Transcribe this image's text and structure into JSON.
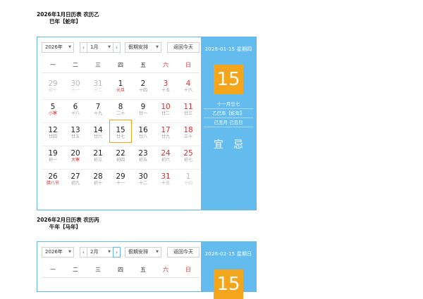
{
  "months": [
    {
      "title_line1": "2026年1月日历表  农历乙",
      "title_line2": "巳年【蛇年】",
      "toolbar": {
        "year": "2026年",
        "prev": "‹",
        "month": "1月",
        "next": "›",
        "holiday": "假期安排",
        "today": "返回今天"
      },
      "weekdays": [
        "一",
        "二",
        "三",
        "四",
        "五",
        "六",
        "日"
      ],
      "weeks": [
        [
          {
            "d": "29",
            "l": "初十",
            "o": true
          },
          {
            "d": "30",
            "l": "十一",
            "o": true
          },
          {
            "d": "31",
            "l": "十二",
            "o": true
          },
          {
            "d": "1",
            "l": "元旦",
            "f": true
          },
          {
            "d": "2",
            "l": "十四"
          },
          {
            "d": "3",
            "l": "十五",
            "w": true
          },
          {
            "d": "4",
            "l": "十六",
            "w": true
          }
        ],
        [
          {
            "d": "5",
            "l": "小寒",
            "f": true
          },
          {
            "d": "6",
            "l": "十八"
          },
          {
            "d": "7",
            "l": "十九"
          },
          {
            "d": "8",
            "l": "二十"
          },
          {
            "d": "9",
            "l": "廿一"
          },
          {
            "d": "10",
            "l": "廿二",
            "w": true
          },
          {
            "d": "11",
            "l": "廿三",
            "w": true
          }
        ],
        [
          {
            "d": "12",
            "l": "廿四"
          },
          {
            "d": "13",
            "l": "廿五"
          },
          {
            "d": "14",
            "l": "廿六"
          },
          {
            "d": "15",
            "l": "廿七",
            "s": true
          },
          {
            "d": "16",
            "l": "廿八"
          },
          {
            "d": "17",
            "l": "廿九",
            "w": true
          },
          {
            "d": "18",
            "l": "三十",
            "w": true
          }
        ],
        [
          {
            "d": "19",
            "l": "初一"
          },
          {
            "d": "20",
            "l": "大寒",
            "f": true
          },
          {
            "d": "21",
            "l": "初三"
          },
          {
            "d": "22",
            "l": "初四"
          },
          {
            "d": "23",
            "l": "初五"
          },
          {
            "d": "24",
            "l": "初六",
            "w": true
          },
          {
            "d": "25",
            "l": "初七",
            "w": true
          }
        ],
        [
          {
            "d": "26",
            "l": "腊八节",
            "f": true
          },
          {
            "d": "27",
            "l": "初九"
          },
          {
            "d": "28",
            "l": "初十"
          },
          {
            "d": "29",
            "l": "十一"
          },
          {
            "d": "30",
            "l": "十二"
          },
          {
            "d": "31",
            "l": "十三",
            "w": true
          },
          {
            "d": "1",
            "l": "十四",
            "o": true
          }
        ]
      ],
      "side": {
        "date": "2026-01-15 星期四",
        "day": "15",
        "lunar": "十一月廿七",
        "year_gz": "乙巳年【蛇年】",
        "month_day_gz": "己丑月 己丑日",
        "yi": "宜",
        "ji": "忌"
      }
    },
    {
      "title_line1": "2026年2月日历表  农历丙",
      "title_line2": "午年【马年】",
      "toolbar": {
        "year": "2026年",
        "prev": "‹",
        "month": "2月",
        "next": "›",
        "holiday": "假期安排",
        "today": "返回今天"
      },
      "weekdays": [
        "一",
        "二",
        "三",
        "四",
        "五",
        "六",
        "日"
      ],
      "weeks": [],
      "side": {
        "date": "2026-02-15 星期日",
        "day": "15"
      }
    }
  ],
  "colors": {
    "accent_blue": "#63bbee",
    "border_blue": "#62b8ea",
    "selected_orange": "#f0a417",
    "weekend_red": "#d83030"
  }
}
